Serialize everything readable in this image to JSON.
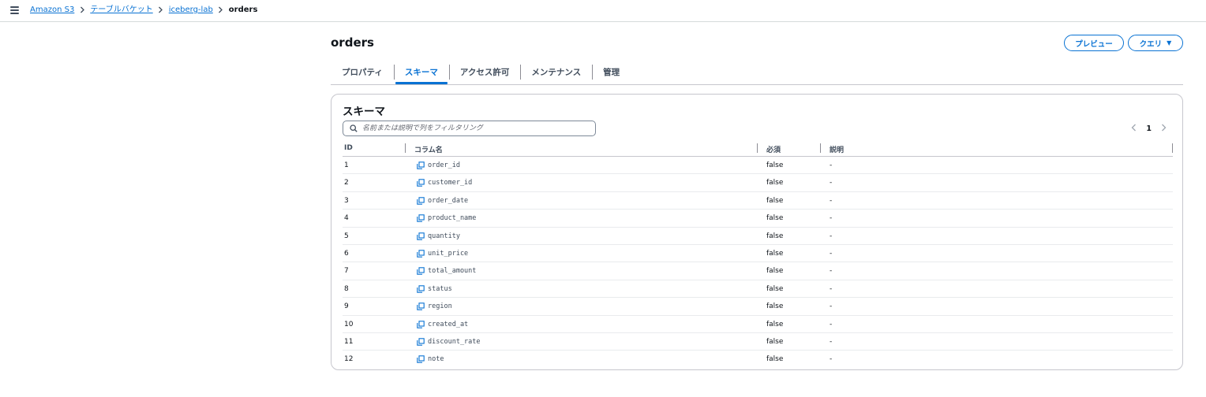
{
  "breadcrumb": {
    "items": [
      "Amazon S3",
      "テーブルバケット",
      "iceberg-lab"
    ],
    "current": "orders"
  },
  "page": {
    "title": "orders",
    "preview_button": "プレビュー",
    "query_button": "クエリ"
  },
  "tabs": [
    {
      "label": "プロパティ",
      "active": false
    },
    {
      "label": "スキーマ",
      "active": true
    },
    {
      "label": "アクセス許可",
      "active": false
    },
    {
      "label": "メンテナンス",
      "active": false
    },
    {
      "label": "管理",
      "active": false
    }
  ],
  "schema": {
    "title": "スキーマ",
    "search_placeholder": "名前または説明で列をフィルタリング",
    "page_number": "1",
    "columns": [
      "ID",
      "コラム名",
      "必須",
      "説明"
    ],
    "rows": [
      {
        "id": "1",
        "name": "order_id",
        "required": "false",
        "description": "-"
      },
      {
        "id": "2",
        "name": "customer_id",
        "required": "false",
        "description": "-"
      },
      {
        "id": "3",
        "name": "order_date",
        "required": "false",
        "description": "-"
      },
      {
        "id": "4",
        "name": "product_name",
        "required": "false",
        "description": "-"
      },
      {
        "id": "5",
        "name": "quantity",
        "required": "false",
        "description": "-"
      },
      {
        "id": "6",
        "name": "unit_price",
        "required": "false",
        "description": "-"
      },
      {
        "id": "7",
        "name": "total_amount",
        "required": "false",
        "description": "-"
      },
      {
        "id": "8",
        "name": "status",
        "required": "false",
        "description": "-"
      },
      {
        "id": "9",
        "name": "region",
        "required": "false",
        "description": "-"
      },
      {
        "id": "10",
        "name": "created_at",
        "required": "false",
        "description": "-"
      },
      {
        "id": "11",
        "name": "discount_rate",
        "required": "false",
        "description": "-"
      },
      {
        "id": "12",
        "name": "note",
        "required": "false",
        "description": "-"
      }
    ]
  },
  "colors": {
    "accent": "#0972d3",
    "text": "#0f141a",
    "border": "#c6c6cd"
  },
  "icons": [
    "menu-icon",
    "chevron-right-icon",
    "search-icon",
    "chevron-left-icon",
    "copy-icon",
    "caret-down-icon"
  ]
}
